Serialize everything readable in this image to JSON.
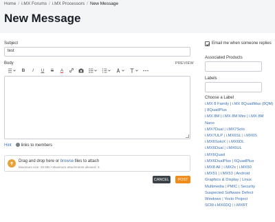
{
  "breadcrumbs": [
    "Home",
    "i.MX Forums",
    "i.MX Processors",
    "New Message"
  ],
  "page_title": "New Message",
  "subject": {
    "label": "Subject",
    "value": "test"
  },
  "body": {
    "label": "Body",
    "preview_label": "PREVIEW"
  },
  "toolbar": {
    "style_icon": "paragraph-style-icon",
    "bold": "B",
    "italic": "I",
    "underline": "U",
    "strikethrough": "S",
    "text_color": "A",
    "link_icon": "link-icon",
    "image_icon": "camera-icon",
    "bulleted_list": "☰",
    "numbered_list": "⋮≡",
    "text_color_2": "A",
    "font_size": "T↕",
    "more": "⋯"
  },
  "hint": {
    "label": "Hint",
    "text": "links to members"
  },
  "upload": {
    "text_before": "Drag and drop here or ",
    "browse": "browse",
    "text_after": " files to attach",
    "limits": "Maximum size: 25 MB • Maximum attachments allowed: 5"
  },
  "buttons": {
    "cancel": "CANCEL",
    "post": "POST"
  },
  "sidebar": {
    "email_notify": "Email me when someone replies",
    "email_checked": true,
    "associated_products_label": "Associated Products",
    "labels_label": "Labels",
    "choose_label": "Choose a Label"
  },
  "label_options": [
    "i.MX 8 Family | i.MX 8QuadMax (8QM) | 8QuadPlus",
    "i.MX 8M | i.MX 8M Mini | i.MX 8M Nano",
    "i.MX7Dual",
    "i.MX7Solo",
    "i.MX7ULP",
    "i.MX6SL",
    "i.MX6S",
    "i.MX6SoloX",
    "i.MX6DL",
    "i.MX6Dual",
    "i.MX6UL",
    "i.MX6Quad",
    "i.MX6DualPlus | 6QuadPlus",
    "i.MX8 All",
    "i.MX2x",
    "i.MX50",
    "i.MX51",
    "i.MX53",
    "Android",
    "Graphics & Display",
    "Linux",
    "Multimedia",
    "PMIC",
    "Security",
    "Suspected Software Defect",
    "Windows",
    "Yocto Project",
    "SCM-i.MX6DQ",
    "i.MXRT"
  ]
}
